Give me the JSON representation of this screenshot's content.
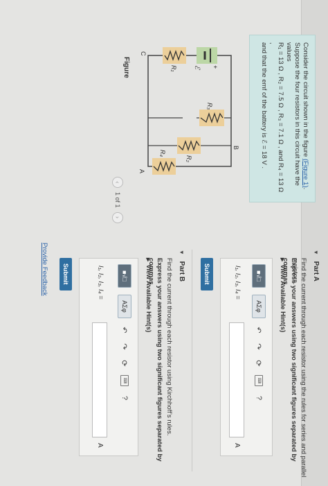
{
  "problem": {
    "line1": "Consider the circuit shown in the figure",
    "figure_link": "(Figure 1)",
    "line1_end": ".",
    "line2": "Suppose the four resistors in this circuit have the values",
    "line3": "R₁ = 13 Ω , R₂ = 7.5 Ω , R₃ = 7.1 Ω , and R₄ = 13 Ω ,",
    "line4": "and that the emf of the battery is ℰ = 18 V ."
  },
  "figure": {
    "label": "Figure",
    "pager_text": "1 of 1",
    "prev_icon": "chevron-left-icon",
    "next_icon": "chevron-right-icon",
    "labels": {
      "r1": "R₁",
      "r2": "R₂",
      "r3": "R₃",
      "r4": "R₄",
      "emf": "ℰ",
      "node_a": "A",
      "node_b": "B",
      "node_c": "C",
      "plus": "+"
    }
  },
  "partA": {
    "title": "Part A",
    "question": "Find the current through each resistor using the rules for series and parallel resistors.",
    "instruction": "Express your answers using two significant figures separated by commas.",
    "hint": "View Available Hint(s)",
    "answer_label": "I₁, I₂, I₃, I₄ =",
    "unit": "A",
    "submit": "Submit",
    "toolbar": {
      "templates": "■√□",
      "greek": "AΣφ",
      "undo_icon": "↶",
      "redo_icon": "↷",
      "reset_icon": "⟳",
      "keyboard_icon": "keyboard",
      "help": "?"
    }
  },
  "partB": {
    "title": "Part B",
    "question": "Find the current through each resistor using Kirchhoff’s rules.",
    "instruction": "Express your answers using two significant figures separated by commas.",
    "hint": "View Available Hint(s)",
    "answer_label": "I₁, I₂, I₃, I₄ =",
    "unit": "A",
    "submit": "Submit",
    "toolbar": {
      "templates": "■√□",
      "greek": "AΣφ",
      "undo_icon": "↶",
      "redo_icon": "↷",
      "reset_icon": "⟳",
      "keyboard_icon": "keyboard",
      "help": "?"
    }
  },
  "footer": {
    "feedback": "Provide Feedback"
  },
  "colors": {
    "accent": "#2f6fa1",
    "problem_bg": "#cfe6e4",
    "battery_bg": "#bcd7a6",
    "resistor_bg": "#eccf9a",
    "link": "#2a62a8"
  }
}
